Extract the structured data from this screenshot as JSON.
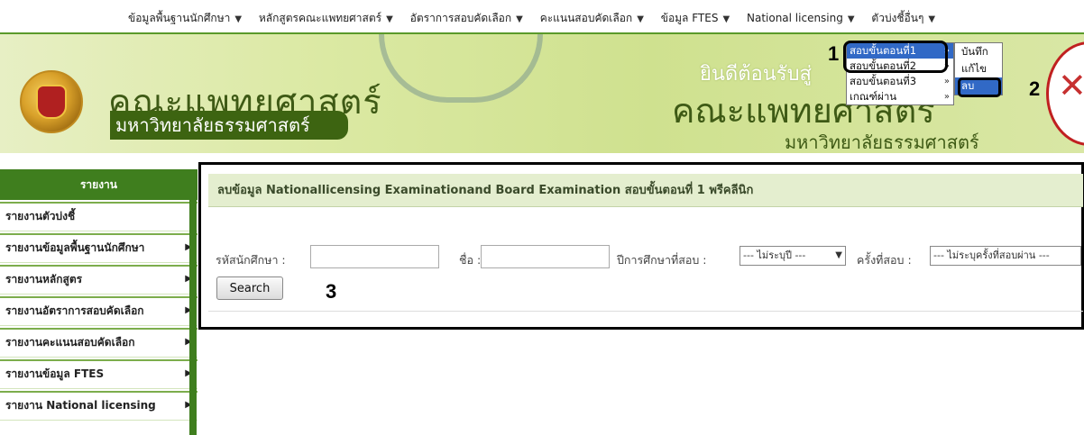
{
  "top_nav": [
    {
      "label": "ข้อมูลพื้นฐานนักศึกษา",
      "icon": "chevron-down-icon"
    },
    {
      "label": "หลักสูตรคณะแพทยศาสตร์",
      "icon": "chevron-down-icon"
    },
    {
      "label": "อัตราการสอบคัดเลือก",
      "icon": "chevron-down-icon"
    },
    {
      "label": "คะแนนสอบคัดเลือก",
      "icon": "chevron-down-icon"
    },
    {
      "label": "ข้อมูล FTES",
      "icon": "chevron-down-icon"
    },
    {
      "label": "National licensing",
      "icon": "chevron-down-icon"
    },
    {
      "label": "ตัวบ่งชี้อื่นๆ",
      "icon": "chevron-down-icon"
    }
  ],
  "banner": {
    "faculty": "คณะแพทยศาสตร์",
    "university": "มหาวิทยาลัยธรรมศาสตร์",
    "welcome": "ยินดีต้อนรับสู่",
    "faculty_right": "คณะแพทยศาสตร์",
    "university_right": "มหาวิทยาลัยธรรมศาสตร์"
  },
  "dropdown": {
    "items": [
      "สอบขั้นตอนที่1",
      "สอบขั้นตอนที่2",
      "สอบขั้นตอนที่3",
      "เกณฑ์ผ่าน"
    ],
    "arrow": "»",
    "active_index": 0
  },
  "submenu": {
    "items": [
      "บันทึก",
      "แก้ไข",
      "ลบ"
    ],
    "active_index": 2
  },
  "annotations": [
    "1",
    "2",
    "3"
  ],
  "sidebar": {
    "header": "รายงาน",
    "items": [
      {
        "label": "รายงานตัวบ่งชี้",
        "arrow": ""
      },
      {
        "label": "รายงานข้อมูลพื้นฐานนักศึกษา",
        "arrow": "▶"
      },
      {
        "label": "รายงานหลักสูตร",
        "arrow": "▶"
      },
      {
        "label": "รายงานอัตราการสอบคัดเลือก",
        "arrow": "▶"
      },
      {
        "label": "รายงานคะแนนสอบคัดเลือก",
        "arrow": "▶"
      },
      {
        "label": "รายงานข้อมูล FTES",
        "arrow": "▶"
      },
      {
        "label": "รายงาน National licensing",
        "arrow": "▶"
      }
    ]
  },
  "main": {
    "title": "ลบข้อมูล Nationallicensing Examinationand Board Examination สอบขั้นตอนที่ 1 พรีคลีนิก",
    "form": {
      "student_id_label": "รหัสนักศึกษา :",
      "student_id_value": "",
      "name_label": "ชื่อ :",
      "name_value": "",
      "year_label": "ปีการศึกษาที่สอบ :",
      "year_value": "--- ไม่ระบุปี ---",
      "attempt_label": "ครั้งที่สอบ :",
      "attempt_value": "--- ไม่ระบุครั้งที่สอบผ่าน ---",
      "search_label": "Search"
    }
  },
  "colors": {
    "accent_green": "#3f7e1e",
    "menu_highlight": "#3169c6",
    "header_bg": "#e4eecf"
  }
}
